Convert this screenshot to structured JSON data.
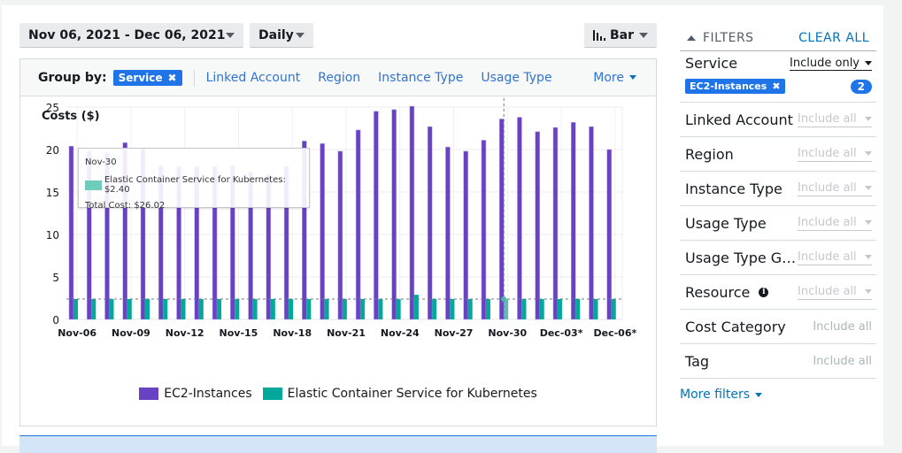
{
  "toolbar": {
    "date_range": "Nov 06, 2021 - Dec 06, 2021",
    "granularity": "Daily",
    "chart_type": "Bar"
  },
  "group_by": {
    "label": "Group by:",
    "active_chip": "Service",
    "options": [
      "Linked Account",
      "Region",
      "Instance Type",
      "Usage Type"
    ],
    "more_label": "More"
  },
  "tooltip": {
    "date": "Nov-30",
    "series_line": "Elastic Container Service for Kubernetes: $2.40",
    "total": "Total Cost: $26.02"
  },
  "filters": {
    "title": "FILTERS",
    "clear_all": "CLEAR ALL",
    "service": {
      "label": "Service",
      "mode": "Include only",
      "chip": "EC2-Instances",
      "count": "2"
    },
    "rows": [
      {
        "label": "Linked Account",
        "value": "Include all",
        "dropdown": true
      },
      {
        "label": "Region",
        "value": "Include all",
        "dropdown": true
      },
      {
        "label": "Instance Type",
        "value": "Include all",
        "dropdown": true
      },
      {
        "label": "Usage Type",
        "value": "Include all",
        "dropdown": true
      },
      {
        "label": "Usage Type G…",
        "value": "Include all",
        "dropdown": true
      },
      {
        "label": "Resource",
        "value": "Include all",
        "dropdown": true,
        "info": true
      },
      {
        "label": "Cost Category",
        "value": "Include all",
        "dropdown": false
      },
      {
        "label": "Tag",
        "value": "Include all",
        "dropdown": false
      }
    ],
    "more_filters": "More filters"
  },
  "colors": {
    "ec2": "#6842c2",
    "eks": "#03a89a",
    "link": "#3073d3",
    "chip": "#1f74e8"
  },
  "chart_data": {
    "type": "bar",
    "title": "",
    "ylabel": "Costs ($)",
    "xlabel": "",
    "ylim": [
      0,
      25
    ],
    "yticks": [
      0,
      5,
      10,
      15,
      20,
      25
    ],
    "grid": true,
    "legend_position": "bottom",
    "categories": [
      "Nov-06",
      "Nov-07",
      "Nov-08",
      "Nov-09",
      "Nov-10",
      "Nov-11",
      "Nov-12",
      "Nov-13",
      "Nov-14",
      "Nov-15",
      "Nov-16",
      "Nov-17",
      "Nov-18",
      "Nov-19",
      "Nov-20",
      "Nov-21",
      "Nov-22",
      "Nov-23",
      "Nov-24",
      "Nov-25",
      "Nov-26",
      "Nov-27",
      "Nov-28",
      "Nov-29",
      "Nov-30",
      "Dec-01",
      "Dec-02",
      "Dec-03",
      "Dec-04",
      "Dec-05",
      "Dec-06"
    ],
    "xtick_labels": [
      "Nov-06",
      "Nov-09",
      "Nov-12",
      "Nov-15",
      "Nov-18",
      "Nov-21",
      "Nov-24",
      "Nov-27",
      "Nov-30",
      "Dec-03*",
      "Dec-06*"
    ],
    "series": [
      {
        "name": "EC2-Instances",
        "values": [
          20.4,
          19.8,
          19.6,
          20.8,
          20.1,
          18.1,
          18.0,
          18.0,
          18.0,
          18.1,
          17.3,
          17.0,
          18.0,
          21.0,
          20.7,
          19.8,
          22.3,
          24.5,
          24.7,
          25.1,
          22.7,
          20.3,
          19.8,
          21.1,
          23.6,
          23.8,
          22.1,
          22.6,
          23.2,
          22.7,
          20.0
        ]
      },
      {
        "name": "Elastic Container Service for Kubernetes",
        "values": [
          2.4,
          2.4,
          2.4,
          2.4,
          2.4,
          2.4,
          2.4,
          2.4,
          2.4,
          2.4,
          2.4,
          2.4,
          2.4,
          2.4,
          2.4,
          2.4,
          2.4,
          2.4,
          2.4,
          2.9,
          2.4,
          2.4,
          2.4,
          2.4,
          2.4,
          2.4,
          2.4,
          2.4,
          2.4,
          2.4,
          2.4
        ]
      }
    ],
    "reference_line": 2.4,
    "highlight_category": "Nov-30"
  }
}
